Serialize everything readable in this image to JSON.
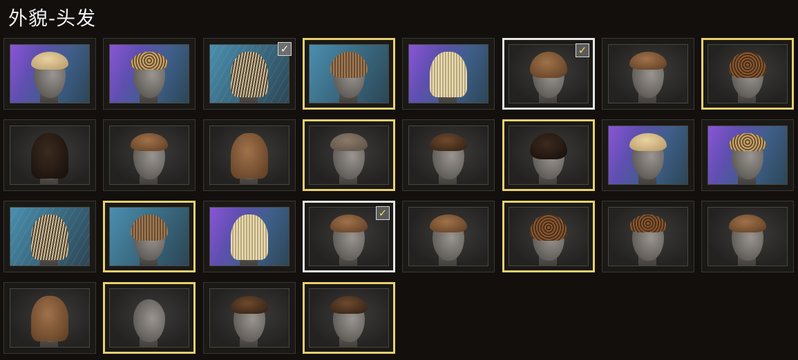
{
  "title": "外貌-头发",
  "check_glyph": "✓",
  "tiles": [
    {
      "bg": "purple",
      "hair": "blonde",
      "style": "short",
      "sel": "none"
    },
    {
      "bg": "purple",
      "hair": "curly-blonde",
      "style": "short",
      "sel": "none"
    },
    {
      "bg": "stripe",
      "hair": "streak",
      "style": "long",
      "sel": "none",
      "check": "grey"
    },
    {
      "bg": "blue",
      "hair": "bowl",
      "style": "normal",
      "sel": "gold"
    },
    {
      "bg": "purple",
      "hair": "crimp",
      "style": "long",
      "sel": "none"
    },
    {
      "bg": "dark",
      "hair": "brown",
      "style": "normal",
      "sel": "white",
      "check": "gold"
    },
    {
      "bg": "dark",
      "hair": "brown",
      "style": "short",
      "sel": "none"
    },
    {
      "bg": "dark",
      "hair": "afro",
      "style": "normal",
      "sel": "gold"
    },
    {
      "bg": "dark",
      "hair": "black",
      "style": "long",
      "sel": "none"
    },
    {
      "bg": "dark",
      "hair": "brown",
      "style": "short",
      "sel": "none"
    },
    {
      "bg": "dark",
      "hair": "brown",
      "style": "long",
      "sel": "none"
    },
    {
      "bg": "dark",
      "hair": "buzz",
      "style": "short",
      "sel": "gold"
    },
    {
      "bg": "dark",
      "hair": "dark-brown",
      "style": "short",
      "sel": "none"
    },
    {
      "bg": "dark",
      "hair": "black",
      "style": "normal",
      "sel": "gold"
    },
    {
      "bg": "purple",
      "hair": "blonde",
      "style": "short",
      "sel": "none"
    },
    {
      "bg": "purple",
      "hair": "curly-blonde",
      "style": "short",
      "sel": "none"
    },
    {
      "bg": "stripe",
      "hair": "streak",
      "style": "long",
      "sel": "none"
    },
    {
      "bg": "blue",
      "hair": "bowl",
      "style": "normal",
      "sel": "gold"
    },
    {
      "bg": "purple",
      "hair": "crimp",
      "style": "long",
      "sel": "none"
    },
    {
      "bg": "dark",
      "hair": "brown",
      "style": "short",
      "sel": "white",
      "check": "gold"
    },
    {
      "bg": "dark",
      "hair": "brown",
      "style": "short",
      "sel": "none"
    },
    {
      "bg": "dark",
      "hair": "afro",
      "style": "normal",
      "sel": "gold"
    },
    {
      "bg": "dark",
      "hair": "afro",
      "style": "short",
      "sel": "none"
    },
    {
      "bg": "dark",
      "hair": "brown",
      "style": "short",
      "sel": "none"
    },
    {
      "bg": "dark",
      "hair": "brown",
      "style": "long",
      "sel": "none"
    },
    {
      "bg": "dark",
      "hair": "none",
      "style": "none",
      "sel": "gold"
    },
    {
      "bg": "dark",
      "hair": "dark-brown",
      "style": "short",
      "sel": "none"
    },
    {
      "bg": "dark",
      "hair": "dark-brown",
      "style": "short",
      "sel": "gold"
    }
  ]
}
